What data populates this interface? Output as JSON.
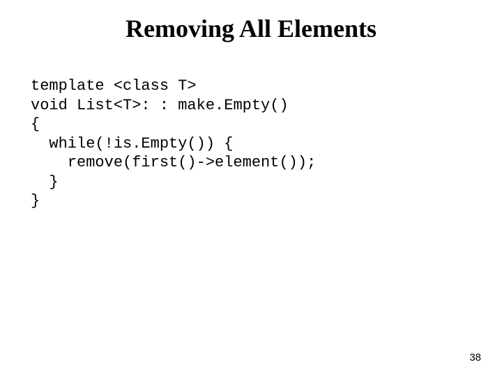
{
  "slide": {
    "title": "Removing All Elements",
    "code": {
      "l1": "template <class T>",
      "l2": "void List<T>: : make.Empty()",
      "l3": "{",
      "l4": "  while(!is.Empty()) {",
      "l5": "    remove(first()->element());",
      "l6": "  }",
      "l7": "}"
    },
    "page_number": "38"
  }
}
